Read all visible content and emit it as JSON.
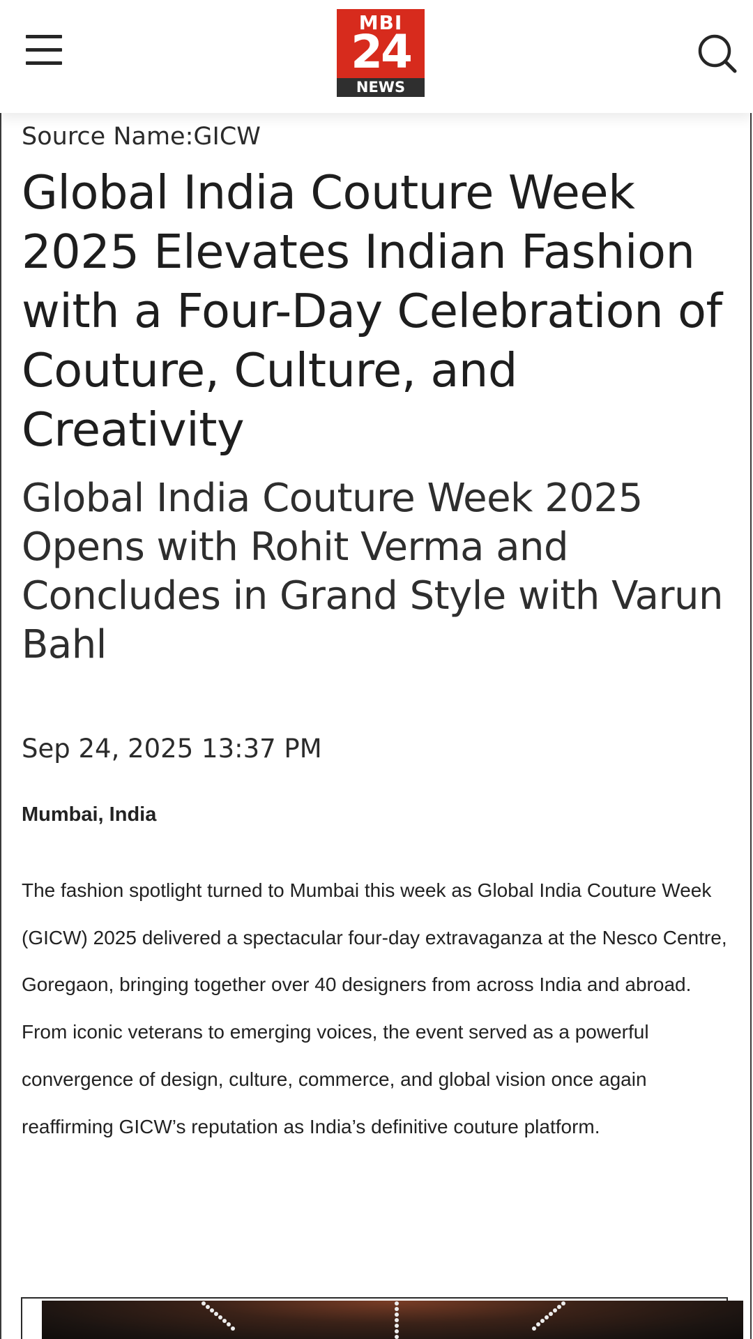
{
  "header": {
    "menu_icon": "hamburger-menu-icon",
    "search_icon": "search-icon",
    "logo": {
      "top": "MBI",
      "number": "24",
      "bottom": "NEWS",
      "color": "#d72b1d",
      "band_color": "#2f2f2f"
    }
  },
  "article": {
    "source": "Source Name:GICW",
    "title": "Global India Couture Week 2025 Elevates Indian Fashion with a Four-Day Celebration of Couture, Culture, and Creativity",
    "subtitle": "Global India Couture Week 2025 Opens with Rohit Verma and Concludes in Grand Style with Varun Bahl",
    "date": "Sep 24, 2025 13:37 PM",
    "location": "Mumbai, India",
    "body": "The fashion spotlight turned to Mumbai this week as Global India Couture Week (GICW) 2025 delivered a spectacular four-day extravaganza at the Nesco Centre, Goregaon, bringing together over 40 designers from across India and abroad. From iconic veterans to emerging voices, the event served as a powerful convergence of design, culture, commerce, and global vision once again reaffirming GICW’s reputation as India’s definitive couture platform."
  }
}
